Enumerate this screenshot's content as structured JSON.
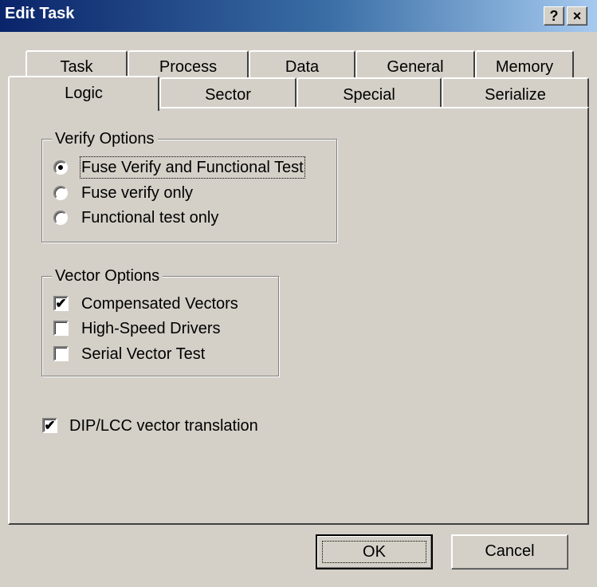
{
  "window": {
    "title": "Edit Task",
    "help_glyph": "?",
    "close_glyph": "×"
  },
  "tabs": {
    "row1": [
      "Task",
      "Process",
      "Data",
      "General",
      "Memory"
    ],
    "row2": [
      "Logic",
      "Sector",
      "Special",
      "Serialize"
    ],
    "selected": "Logic"
  },
  "verify_options": {
    "legend": "Verify Options",
    "options": [
      {
        "label": "Fuse Verify and Functional Test",
        "selected": true
      },
      {
        "label": "Fuse verify only",
        "selected": false
      },
      {
        "label": "Functional test only",
        "selected": false
      }
    ]
  },
  "vector_options": {
    "legend": "Vector Options",
    "options": [
      {
        "label": "Compensated Vectors",
        "checked": true
      },
      {
        "label": "High-Speed Drivers",
        "checked": false
      },
      {
        "label": "Serial Vector Test",
        "checked": false
      }
    ]
  },
  "dip_lcc": {
    "label": "DIP/LCC vector translation",
    "checked": true
  },
  "buttons": {
    "ok": "OK",
    "cancel": "Cancel"
  },
  "check_glyph": "✔"
}
